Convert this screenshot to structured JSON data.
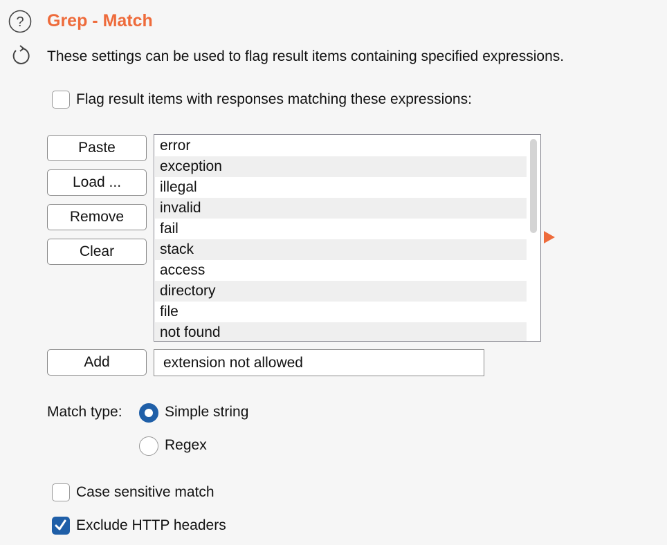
{
  "header": {
    "title": "Grep - Match",
    "description": "These settings can be used to flag result items containing specified expressions."
  },
  "icons": {
    "help": "help-circle-icon",
    "refresh": "refresh-icon"
  },
  "flag_option": {
    "label": "Flag result items with responses matching these expressions:",
    "checked": false
  },
  "buttons": {
    "paste": "Paste",
    "load": "Load ...",
    "remove": "Remove",
    "clear": "Clear",
    "add": "Add"
  },
  "expressions": [
    "error",
    "exception",
    "illegal",
    "invalid",
    "fail",
    "stack",
    "access",
    "directory",
    "file",
    "not found"
  ],
  "add_input": {
    "value": "extension not allowed"
  },
  "match_type": {
    "label": "Match type:",
    "options": [
      "Simple string",
      "Regex"
    ],
    "selected": "Simple string"
  },
  "options": {
    "case_sensitive": {
      "label": "Case sensitive match",
      "checked": false
    },
    "exclude_headers": {
      "label": "Exclude HTTP headers",
      "checked": true
    }
  },
  "colors": {
    "accent": "#ee6b3b",
    "selection": "#1f5fa8"
  }
}
